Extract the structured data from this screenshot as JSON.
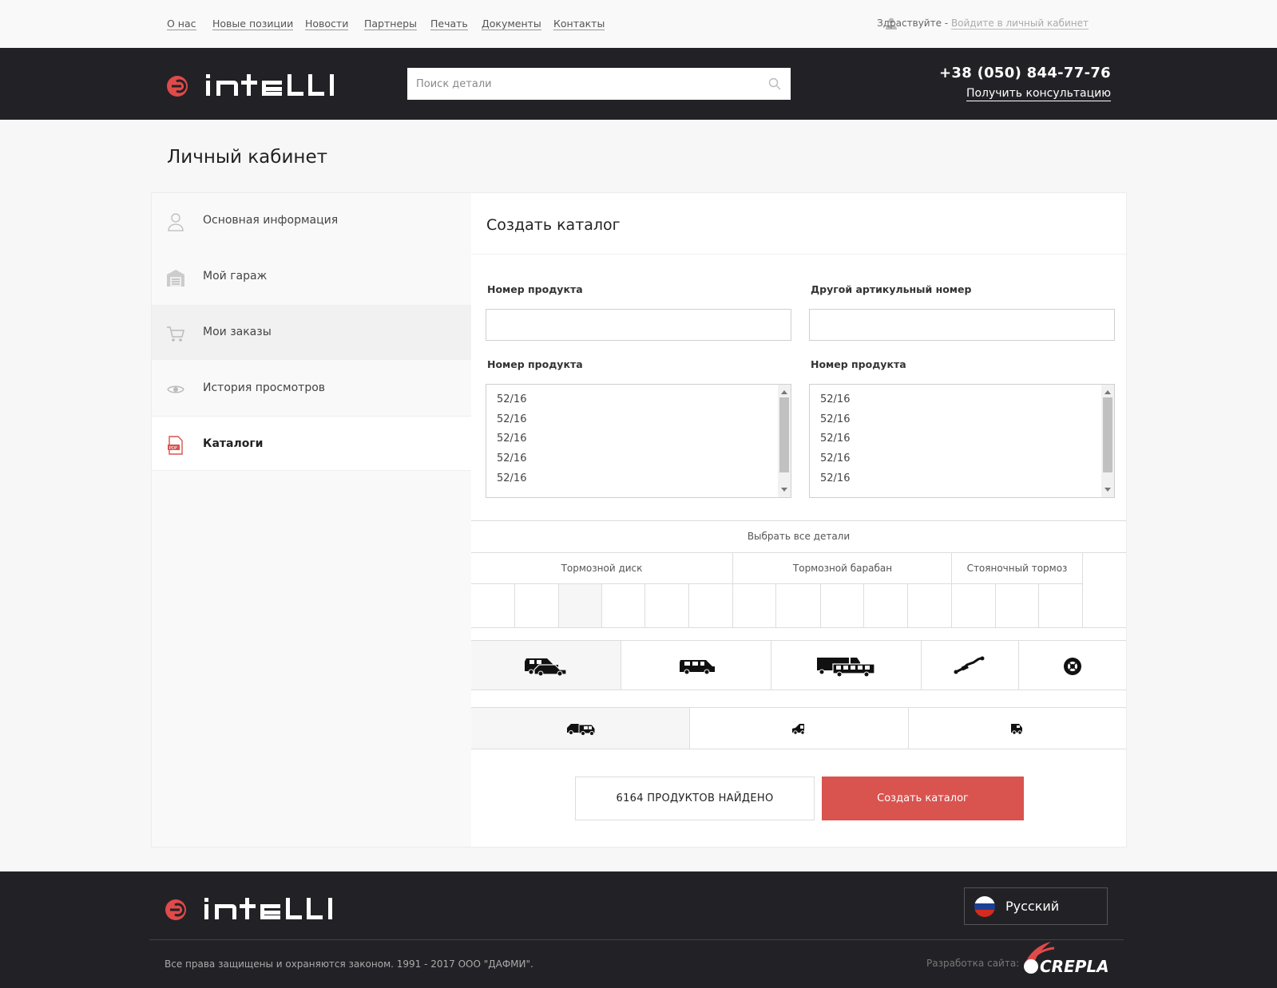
{
  "topnav": {
    "links": [
      "О нас",
      "Новые позиции",
      "Новости",
      "Партнеры",
      "Печать",
      "Документы",
      "Контакты"
    ],
    "greeting": "Здраствуйте - ",
    "login": "Войдите в личный кабинет"
  },
  "header": {
    "logo_text": "intelli",
    "search_placeholder": "Поиск детали",
    "phone": "+38 (050) 844-77-76",
    "consult": "Получить консультацию"
  },
  "page_title": "Личный кабинет",
  "sidebar": {
    "items": [
      {
        "label": "Основная информация",
        "icon": "user-icon"
      },
      {
        "label": "Мой гараж",
        "icon": "garage-icon"
      },
      {
        "label": "Мои заказы",
        "icon": "cart-icon"
      },
      {
        "label": "История просмотров",
        "icon": "eye-icon"
      },
      {
        "label": "Каталоги",
        "icon": "pdf-icon"
      }
    ]
  },
  "main": {
    "title": "Создать каталог",
    "field1_label": "Номер продукта",
    "field2_label": "Другой артикульный номер",
    "list1_label": "Номер продукта",
    "list2_label": "Номер продукта",
    "list1_options": [
      "52/16",
      "52/16",
      "52/16",
      "52/16",
      "52/16"
    ],
    "list2_options": [
      "52/16",
      "52/16",
      "52/16",
      "52/16",
      "52/16"
    ],
    "select_all": "Выбрать все детали",
    "categories": [
      "Тормозной диск",
      "Тормозной барабан",
      "Стояночный тормоз"
    ],
    "vehicle_icons": [
      "car-van-icon",
      "minivan-icon",
      "truck-bus-icon",
      "cable-icon",
      "disc-icon"
    ],
    "body_icons": [
      "suv-icon",
      "sedan-icon",
      "crossover-icon"
    ],
    "found": "6164 ПРОДУКТОВ НАЙДЕНО",
    "create_button": "Создать каталог"
  },
  "footer": {
    "logo_text": "intelli",
    "language": "Русский",
    "copyright": "Все права защищены и охраняются законом. 1991 - 2017 ООО \"ДАФМИ\".",
    "dev_by": "Разработка сайта:",
    "dev_logo": "CREPLA"
  },
  "colors": {
    "accent": "#d9534f",
    "dark": "#222226"
  }
}
